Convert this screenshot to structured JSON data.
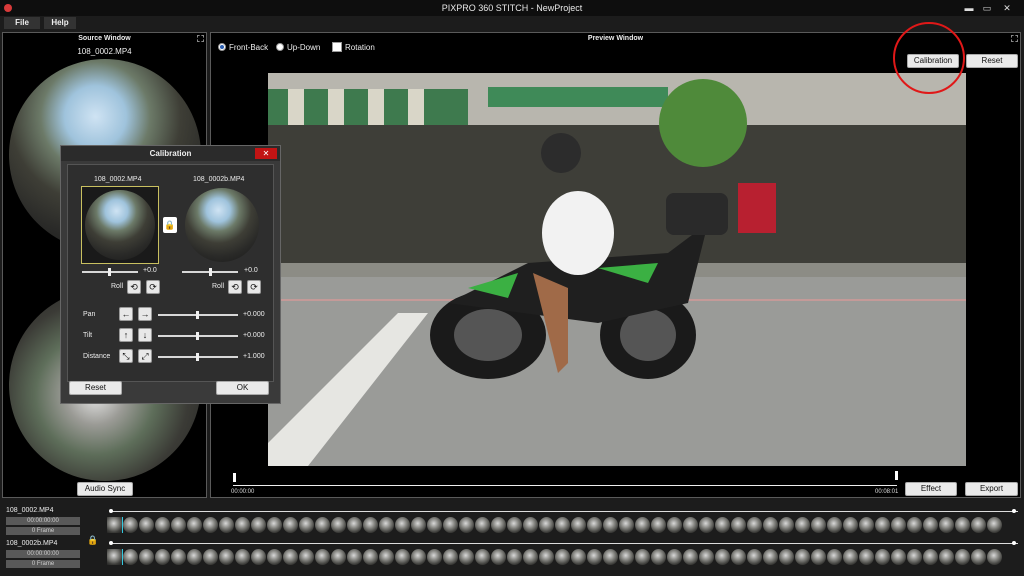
{
  "window": {
    "title": "PIXPRO 360 STITCH - NewProject",
    "controls": {
      "minimize": "▬",
      "restore": "▭",
      "close": "✕"
    }
  },
  "menu": [
    {
      "label": "File"
    },
    {
      "label": "Help"
    }
  ],
  "source": {
    "title": "Source Window",
    "file": "108_0002.MP4",
    "audio_sync": "Audio Sync"
  },
  "preview": {
    "title": "Preview Window",
    "options": {
      "front_back": "Front-Back",
      "up_down": "Up-Down",
      "rotation": "Rotation"
    },
    "calibration_button": "Calibration",
    "reset_button": "Reset",
    "time_start": "00:00:00",
    "time_end": "00:08:01",
    "effect_button": "Effect",
    "export_button": "Export"
  },
  "calibration": {
    "title": "Calibration",
    "close": "✕",
    "left_file": "108_0002.MP4",
    "right_file": "108_0002b.MP4",
    "left_value": "+0.0",
    "right_value": "+0.0",
    "roll": "Roll",
    "pan_label": "Pan",
    "pan_value": "+0.000",
    "tilt_label": "Tilt",
    "tilt_value": "+0.000",
    "distance_label": "Distance",
    "distance_value": "+1.000",
    "reset": "Reset",
    "ok": "OK"
  },
  "timeline": {
    "track1": {
      "file": "108_0002.MP4",
      "time": "00:00:00:00",
      "frame": "0 Frame"
    },
    "track2": {
      "file": "108_0002b.MP4",
      "time": "00:00:00:00",
      "frame": "0 Frame"
    }
  },
  "colors": {
    "highlight": "#e01818",
    "selected_thumb": "#33c9e0",
    "dialog_close": "#c21414"
  }
}
